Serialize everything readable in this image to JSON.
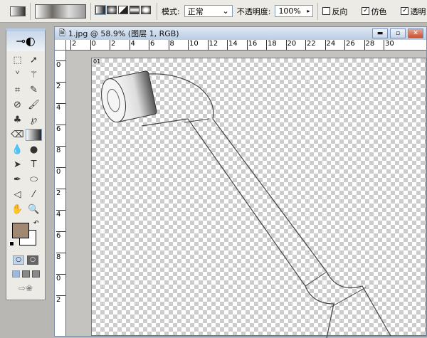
{
  "options_bar": {
    "mode_label": "模式:",
    "mode_value": "正常",
    "opacity_label": "不透明度:",
    "opacity_value": "100%",
    "reverse_label": "反向",
    "reverse_checked": false,
    "dither_label": "仿色",
    "dither_checked": true,
    "transparency_label": "透明",
    "transparency_checked": true,
    "gradient_types": [
      "linear",
      "radial",
      "angle",
      "reflected",
      "diamond"
    ]
  },
  "toolbox": {
    "tools": [
      "marquee",
      "move",
      "lasso",
      "magic-wand",
      "crop",
      "slice",
      "healing-brush",
      "brush",
      "clone-stamp",
      "history-brush",
      "eraser",
      "gradient",
      "blur",
      "dodge",
      "path-selection",
      "type",
      "pen",
      "shape",
      "notes",
      "eyedropper",
      "hand",
      "zoom"
    ],
    "active_tool": "gradient",
    "foreground_color": "#a08873",
    "background_color": "#ffffff"
  },
  "document": {
    "title": "1.jpg @ 58.9% (图层 1, RGB)",
    "ruler_top": [
      "2",
      "0",
      "2",
      "4",
      "6",
      "8",
      "10",
      "12",
      "14",
      "16",
      "18",
      "20",
      "22",
      "24",
      "26",
      "28",
      "30"
    ],
    "ruler_left": [
      "0",
      "2",
      "4",
      "6",
      "8",
      "0",
      "2",
      "4",
      "6",
      "8",
      "0",
      "2"
    ],
    "canvas_label": "01"
  }
}
